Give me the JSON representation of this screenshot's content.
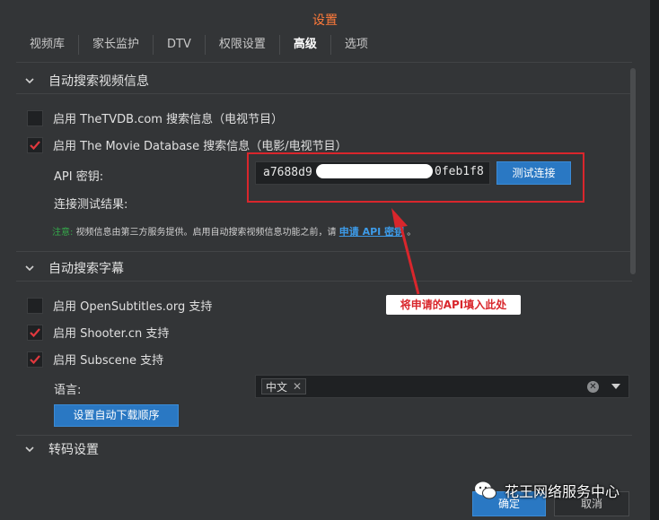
{
  "dialog": {
    "title": "设置"
  },
  "tabs": [
    {
      "label": "视频库"
    },
    {
      "label": "家长监护"
    },
    {
      "label": "DTV"
    },
    {
      "label": "权限设置"
    },
    {
      "label": "高级"
    },
    {
      "label": "选项"
    }
  ],
  "sections": {
    "auto_video_info": {
      "header": "自动搜索视频信息",
      "tvdb_label": "启用 TheTVDB.com 搜索信息（电视节目）",
      "tvdb_checked": false,
      "tmdb_label": "启用 The Movie Database 搜索信息（电影/电视节目）",
      "tmdb_checked": true,
      "api_key_label": "API 密钥:",
      "api_key_value_start": "a7688d9",
      "api_key_value_end": "0feb1f8",
      "test_button": "测试连接",
      "test_result_label": "连接测试结果:",
      "notice_prefix": "注意:",
      "notice_text": "视频信息由第三方服务提供。启用自动搜索视频信息功能之前，请",
      "notice_link": "申请 API 密钥",
      "notice_suffix": "。"
    },
    "auto_subtitle": {
      "header": "自动搜索字幕",
      "opensub_label": "启用 OpenSubtitles.org 支持",
      "opensub_checked": false,
      "shooter_label": "启用 Shooter.cn 支持",
      "shooter_checked": true,
      "subscene_label": "启用 Subscene 支持",
      "subscene_checked": true,
      "language_label": "语言:",
      "language_chip": "中文",
      "download_order_button": "设置自动下载顺序"
    },
    "transcode": {
      "header": "转码设置"
    }
  },
  "annotation": {
    "callout_text": "将申请的API填入此处",
    "highlight_color": "#d9262c"
  },
  "footer": {
    "ok_label": "确定",
    "cancel_label": "取消"
  },
  "watermark": {
    "text": "花王网络服务中心"
  },
  "colors": {
    "accent_title": "#ff7a3a",
    "primary_button": "#2a78c3",
    "check_red": "#e0383e",
    "notice_green": "#35a84a",
    "link_blue": "#3d9be8"
  }
}
